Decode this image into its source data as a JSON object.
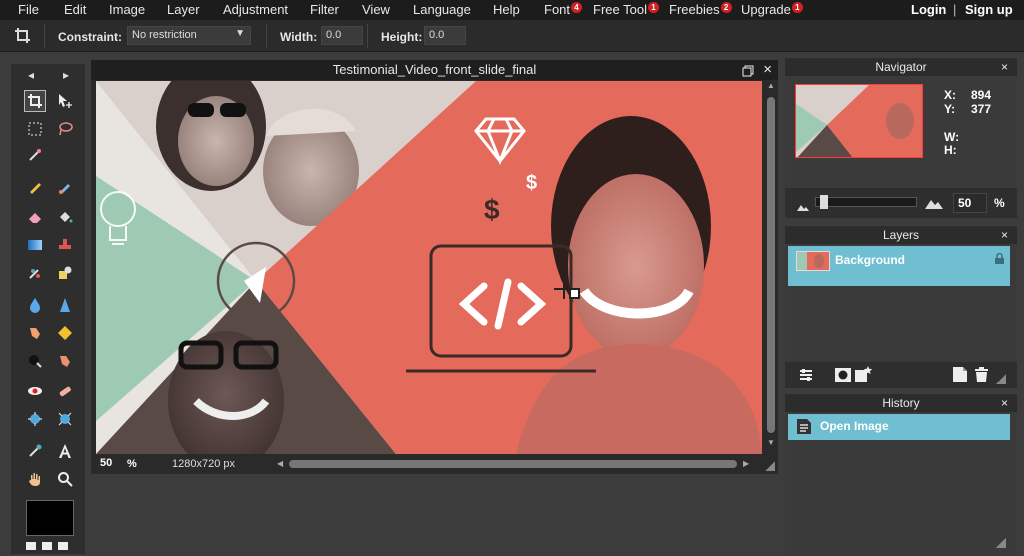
{
  "menu": {
    "items": [
      {
        "label": "File",
        "badge": ""
      },
      {
        "label": "Edit",
        "badge": ""
      },
      {
        "label": "Image",
        "badge": ""
      },
      {
        "label": "Layer",
        "badge": ""
      },
      {
        "label": "Adjustment",
        "badge": ""
      },
      {
        "label": "Filter",
        "badge": ""
      },
      {
        "label": "View",
        "badge": ""
      },
      {
        "label": "Language",
        "badge": ""
      },
      {
        "label": "Help",
        "badge": ""
      },
      {
        "label": "Font",
        "badge": "4"
      },
      {
        "label": "Free Tool",
        "badge": "1"
      },
      {
        "label": "Freebies",
        "badge": "2"
      },
      {
        "label": "Upgrade",
        "badge": "1"
      }
    ],
    "login": "Login",
    "separator": "|",
    "signup": "Sign up"
  },
  "options": {
    "constraint_label": "Constraint:",
    "constraint_value": "No restriction",
    "width_label": "Width:",
    "width_value": "0.0",
    "height_label": "Height:",
    "height_value": "0.0"
  },
  "tools": {
    "nav_left": "◂",
    "nav_right": "▸"
  },
  "document": {
    "title": "Testimonial_Video_front_slide_final",
    "zoom": "50",
    "zoom_unit": "%",
    "dimensions": "1280x720 px"
  },
  "navigator": {
    "title": "Navigator",
    "close": "×",
    "x_label": "X:",
    "x_value": "894",
    "y_label": "Y:",
    "y_value": "377",
    "w_label": "W:",
    "h_label": "H:",
    "zoom_value": "50",
    "zoom_unit": "%",
    "zoom_slider_level": 0.05
  },
  "layers": {
    "title": "Layers",
    "close": "×",
    "items": [
      {
        "name": "Background"
      }
    ]
  },
  "history": {
    "title": "History",
    "close": "×",
    "items": [
      {
        "name": "Open Image"
      }
    ]
  },
  "colors": {
    "coral": "#e46a5c",
    "mint": "#9ec9b2",
    "selection": "#70bed1",
    "menubar": "#1c1c1c"
  }
}
